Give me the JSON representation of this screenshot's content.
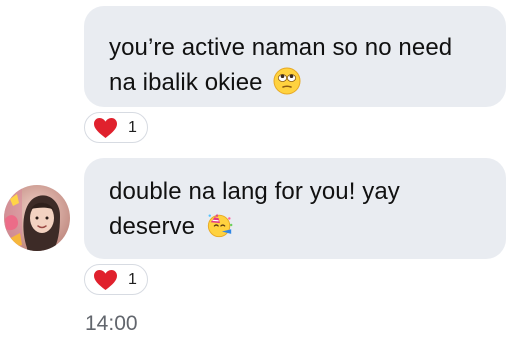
{
  "messages": [
    {
      "lines": [
        "you’re active naman so no need",
        "na ibalik okiee"
      ],
      "emoji": "rolling-eyes-face-icon",
      "reaction": {
        "icon": "heart-icon",
        "count": "1"
      }
    },
    {
      "lines": [
        "double na lang for you! yay",
        "deserve"
      ],
      "emoji": "party-face-icon",
      "reaction": {
        "icon": "heart-icon",
        "count": "1"
      }
    }
  ],
  "footer": {
    "timestamp": "14:00"
  },
  "colors": {
    "bubble": "#e9ecf1",
    "heart": "#e0212d",
    "timestamp": "#62666d"
  }
}
